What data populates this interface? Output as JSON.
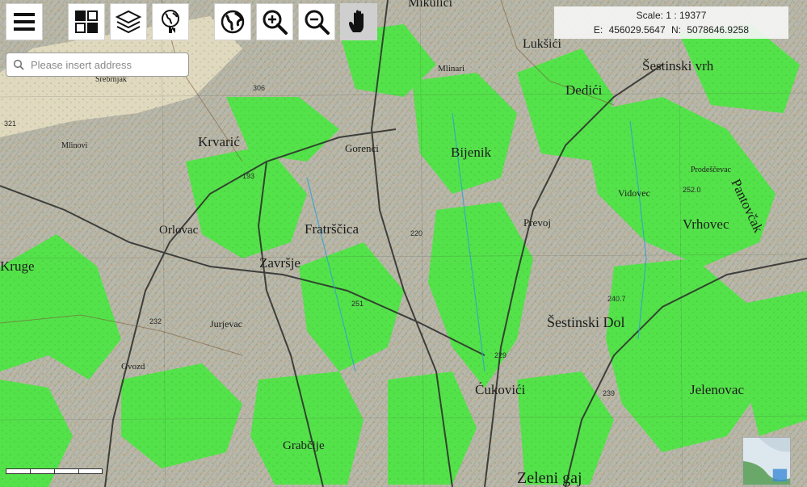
{
  "toolbar": {
    "menu_icon": "hamburger-menu-icon",
    "basemap_icon": "grid-tiles-icon",
    "layers_icon": "layers-stack-icon",
    "locate_icon": "globe-pointer-icon",
    "full_extent_icon": "globe-icon",
    "zoom_in_icon": "magnifier-plus-icon",
    "zoom_out_icon": "magnifier-minus-icon",
    "pan_icon": "hand-icon",
    "active_tool": "pan"
  },
  "search": {
    "placeholder": "Please insert address",
    "value": ""
  },
  "status": {
    "scale_label": "Scale: 1 :",
    "scale_value": "19377",
    "easting_label": "E:",
    "easting_value": "456029.5647",
    "northing_label": "N:",
    "northing_value": "5078646.9258"
  },
  "map": {
    "place_labels": [
      {
        "text": "Mikulići"
      },
      {
        "text": "Lukšići"
      },
      {
        "text": "Mlinari"
      },
      {
        "text": "Šestinski vrh"
      },
      {
        "text": "Dedići"
      },
      {
        "text": "Krvarić"
      },
      {
        "text": "Gorenci"
      },
      {
        "text": "Bijenik"
      },
      {
        "text": "Vidovec"
      },
      {
        "text": "Prevoj"
      },
      {
        "text": "Vrhovec"
      },
      {
        "text": "Fratrščica"
      },
      {
        "text": "Jurjevac"
      },
      {
        "text": "Orlovac"
      },
      {
        "text": "Završje"
      },
      {
        "text": "Pantovčak"
      },
      {
        "text": "Šestinski Dol"
      },
      {
        "text": "Ćukovići"
      },
      {
        "text": "Jelenovac"
      },
      {
        "text": "Grabčije"
      },
      {
        "text": "Gvozd"
      },
      {
        "text": "Mlinovi"
      },
      {
        "text": "Prodeščevac"
      },
      {
        "text": "Srebrnjak"
      },
      {
        "text": "Kruge"
      },
      {
        "text": "Zeleni gaj"
      }
    ],
    "colors": {
      "forest": "#54e24a",
      "urban": "#9a9a9a",
      "terrain": "#b9b7a9",
      "roads": "#2a2a2a",
      "water": "#2f9fd6"
    }
  }
}
